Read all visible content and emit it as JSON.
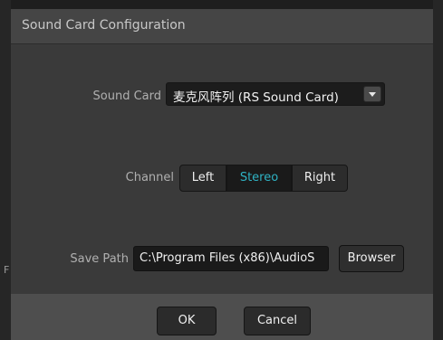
{
  "dialog": {
    "title": "Sound Card Configuration"
  },
  "sound_card": {
    "label": "Sound Card",
    "selected": "麦克风阵列 (RS Sound Card)"
  },
  "channel": {
    "label": "Channel",
    "options": [
      "Left",
      "Stereo",
      "Right"
    ],
    "selected": "Stereo"
  },
  "save_path": {
    "label": "Save Path",
    "value": "C:\\Program Files (x86)\\AudioS",
    "browse_label": "Browser"
  },
  "footer": {
    "ok_label": "OK",
    "cancel_label": "Cancel"
  },
  "background": {
    "edge_mark": "F"
  },
  "colors": {
    "accent": "#2fb3c4",
    "dialog_bg": "#3a3a3a",
    "footer_bg": "#4e4e4e"
  }
}
